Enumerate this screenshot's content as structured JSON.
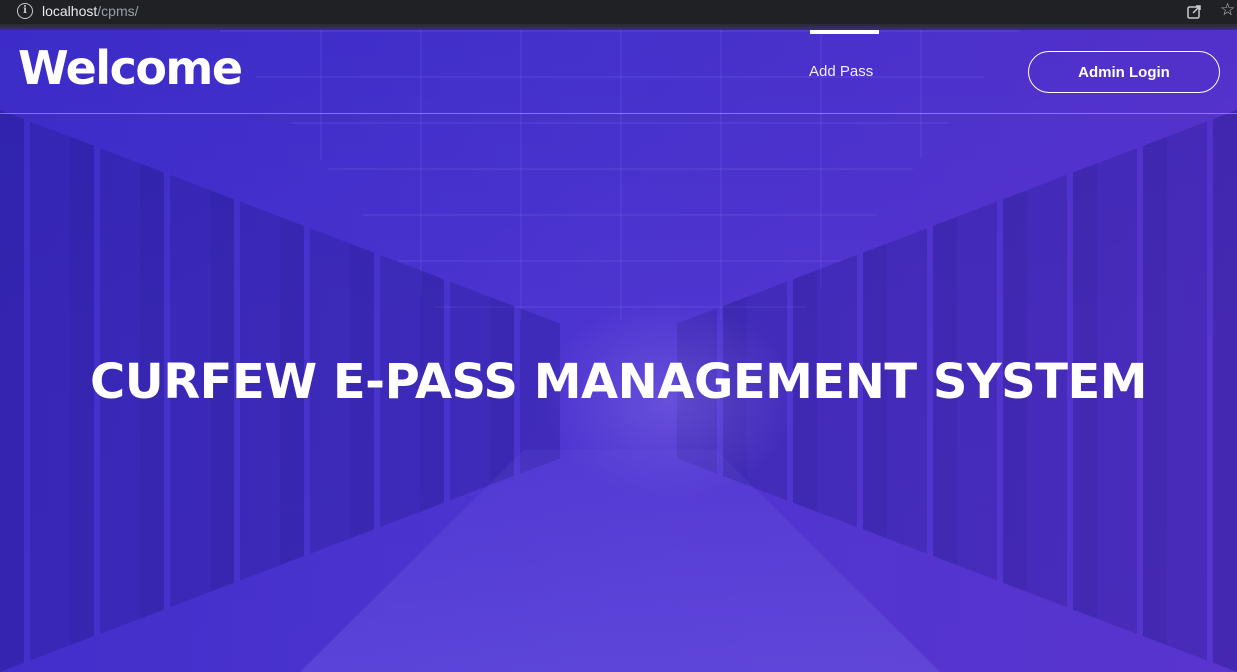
{
  "browser": {
    "url_host": "localhost",
    "url_path": "/cpms/",
    "icons": [
      "info-icon",
      "share-icon",
      "star-icon"
    ]
  },
  "navbar": {
    "title": "Welcome",
    "links": [
      {
        "label": "Add Pass",
        "active": true
      }
    ],
    "admin_button": "Admin Login"
  },
  "hero": {
    "heading": "CURFEW E-PASS MANAGEMENT SYSTEM"
  },
  "colors": {
    "hero_background": "#4a35cf",
    "text": "#ffffff",
    "browser_bar": "#202124"
  }
}
